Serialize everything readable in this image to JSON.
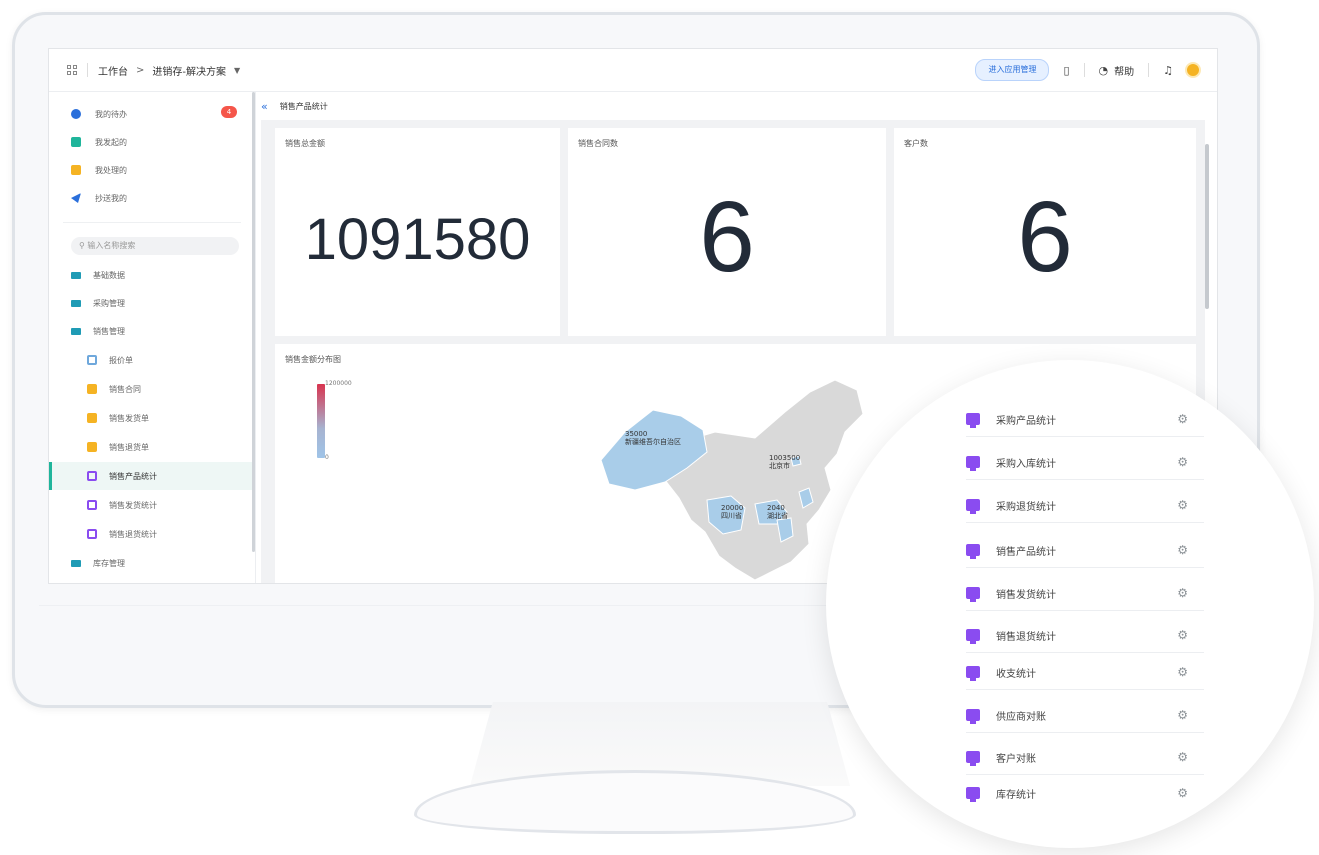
{
  "topbar": {
    "breadcrumb": [
      "工作台",
      "进销存-解决方案"
    ],
    "manage_label": "进入应用管理",
    "help_label": "帮助"
  },
  "sidebar": {
    "todo": [
      {
        "label": "我的待办",
        "color": "#2a6fdb"
      },
      {
        "label": "我发起的",
        "color": "#1fb59b"
      },
      {
        "label": "我处理的",
        "color": "#f5b323"
      },
      {
        "label": "抄送我的",
        "color": "#2a6fdb"
      }
    ],
    "todo_badge": "4",
    "search_placeholder": "输入名称搜索",
    "folders": [
      "基础数据",
      "采购管理",
      "销售管理"
    ],
    "sales_children": [
      {
        "label": "报价单",
        "color": "#6fa8dc"
      },
      {
        "label": "销售合同",
        "color": "#f5b323"
      },
      {
        "label": "销售发货单",
        "color": "#f5b323"
      },
      {
        "label": "销售退货单",
        "color": "#f5b323"
      },
      {
        "label": "销售产品统计",
        "color": "#8a4cf0"
      },
      {
        "label": "销售发货统计",
        "color": "#8a4cf0"
      },
      {
        "label": "销售退货统计",
        "color": "#8a4cf0"
      }
    ],
    "inventory_label": "库存管理"
  },
  "main": {
    "page_title": "销售产品统计",
    "cards": [
      {
        "title": "销售总金额",
        "value": "1091580"
      },
      {
        "title": "销售合同数",
        "value": "6"
      },
      {
        "title": "客户数",
        "value": "6"
      }
    ],
    "map": {
      "title": "销售金额分布图",
      "legend_max": "1200000",
      "legend_min": "0",
      "labels": [
        {
          "value": "35000",
          "region": "新疆维吾尔自治区"
        },
        {
          "value": "1003500",
          "region": "北京市"
        },
        {
          "value": "20000",
          "region": "四川省"
        },
        {
          "value": "2040",
          "region": "湖北省"
        }
      ]
    }
  },
  "zoom_list": [
    "采购产品统计",
    "采购入库统计",
    "采购退货统计",
    "销售产品统计",
    "销售发货统计",
    "销售退货统计",
    "收支统计",
    "供应商对账",
    "客户对账",
    "库存统计"
  ],
  "colors": {
    "accent": "#2a6fdb",
    "active_teal": "#1fb59b",
    "report_icon": "#8a4cf0",
    "badge_red": "#f5564a"
  }
}
